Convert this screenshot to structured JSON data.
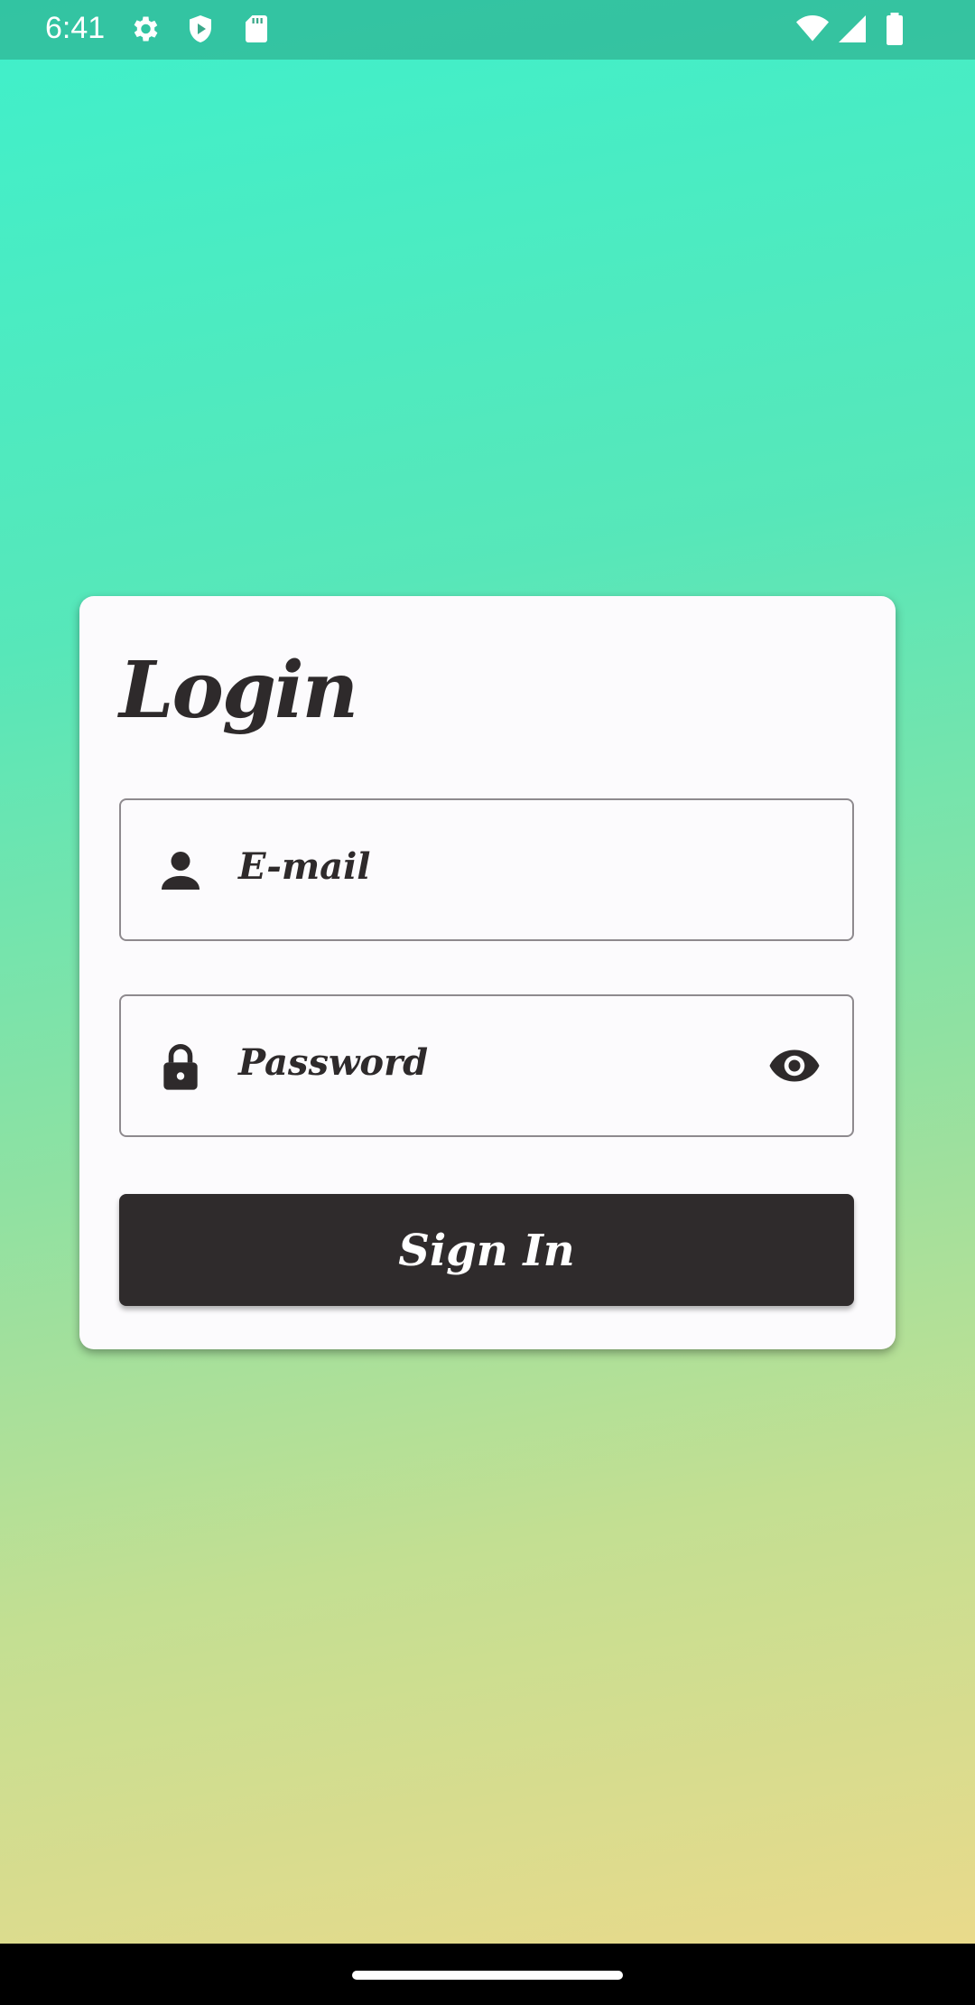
{
  "status_bar": {
    "time": "6:41",
    "icons": [
      "gear-icon",
      "play-shield-icon",
      "sd-card-icon",
      "wifi-icon",
      "signal-icon",
      "battery-icon"
    ]
  },
  "login": {
    "title": "Login",
    "email": {
      "placeholder": "E-mail",
      "value": "",
      "icon": "person-icon"
    },
    "password": {
      "placeholder": "Password",
      "value": "",
      "icon": "lock-icon",
      "toggle_icon": "eye-icon"
    },
    "submit_label": "Sign In"
  },
  "colors": {
    "card_background": "#fcfbfd",
    "button_background": "#2f2b2c",
    "text_dark": "#2e2a2b",
    "gradient_top": "#3ff0cb",
    "gradient_bottom": "#eed98a"
  }
}
